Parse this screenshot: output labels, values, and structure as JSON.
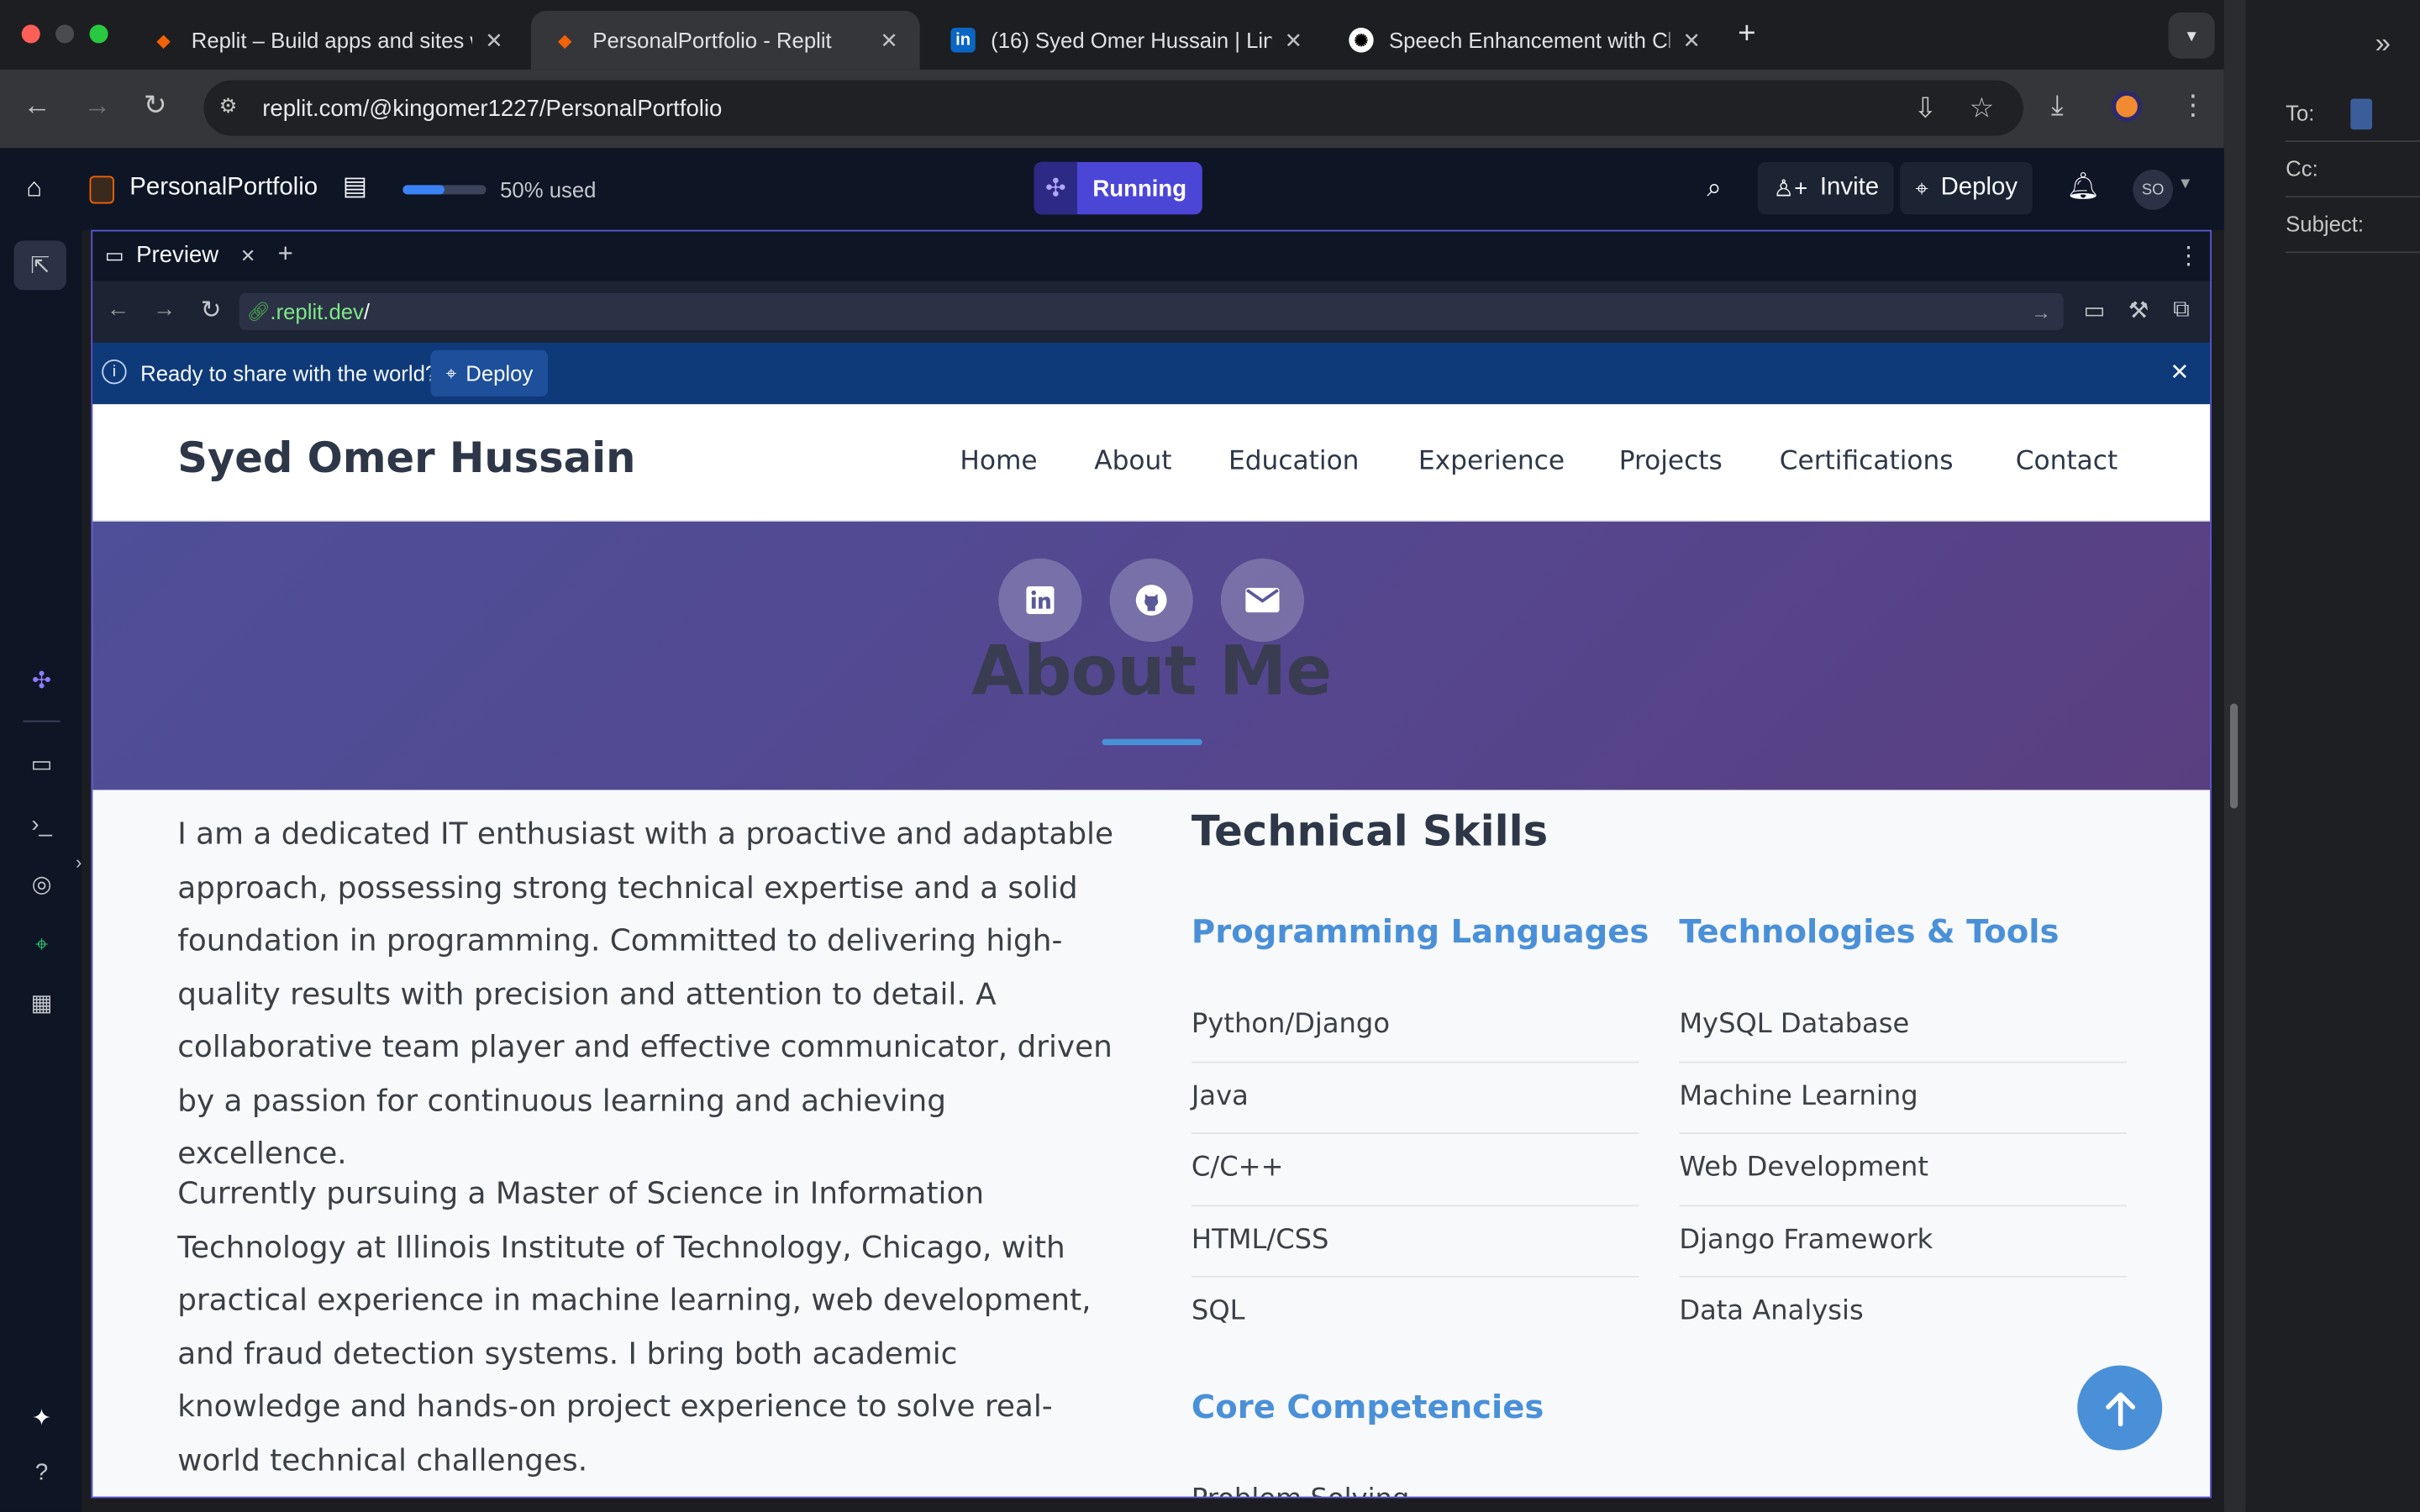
{
  "browser": {
    "tabs": [
      {
        "title": "Replit – Build apps and sites w",
        "favicon": "replit-icon",
        "active": false
      },
      {
        "title": "PersonalPortfolio - Replit",
        "favicon": "replit-icon",
        "active": true
      },
      {
        "title": "(16) Syed Omer Hussain | Link",
        "favicon": "linkedin-icon",
        "active": false
      },
      {
        "title": "Speech Enhancement with Ch",
        "favicon": "openai-icon",
        "active": false
      }
    ],
    "address": "replit.com/@kingomer1227/PersonalPortfolio"
  },
  "mail_compose": {
    "to_label": "To:",
    "cc_label": "Cc:",
    "subject_label": "Subject:"
  },
  "replit": {
    "project_name": "PersonalPortfolio",
    "usage_label": "50% used",
    "usage_fraction": 0.5,
    "run_status": "Running",
    "invite_label": "Invite",
    "deploy_label": "Deploy",
    "avatar_initials": "SO"
  },
  "preview": {
    "tab_label": "Preview",
    "url_host": ".replit.dev",
    "url_path": "/",
    "banner_text": "Ready to share with the world?",
    "banner_button": "Deploy"
  },
  "site": {
    "brand": "Syed Omer Hussain",
    "nav": [
      "Home",
      "About",
      "Education",
      "Experience",
      "Projects",
      "Certifications",
      "Contact"
    ],
    "section_title": "About Me",
    "paragraphs": [
      "I am a dedicated IT enthusiast with a proactive and adaptable approach, possessing strong technical expertise and a solid foundation in programming. Committed to delivering high-quality results with precision and attention to detail. A collaborative team player and effective communicator, driven by a passion for continuous learning and achieving excellence.",
      "Currently pursuing a Master of Science in Information Technology at Illinois Institute of Technology, Chicago, with practical experience in machine learning, web development, and fraud detection systems. I bring both academic knowledge and hands-on project experience to solve real-world technical challenges."
    ],
    "skills": {
      "title": "Technical Skills",
      "programming_title": "Programming Languages",
      "programming": [
        "Python/Django",
        "Java",
        "C/C++",
        "HTML/CSS",
        "SQL"
      ],
      "tools_title": "Technologies & Tools",
      "tools": [
        "MySQL Database",
        "Machine Learning",
        "Web Development",
        "Django Framework",
        "Data Analysis"
      ],
      "core_title": "Core Competencies",
      "core_first": "Problem Solving"
    }
  },
  "colors": {
    "accent": "#4a90d9",
    "replit_bg": "#0e1525",
    "running": "#4c46d7",
    "banner": "#0f3a7a",
    "hero_gradient_start": "#4e4f98",
    "hero_gradient_end": "#5a3f80"
  }
}
